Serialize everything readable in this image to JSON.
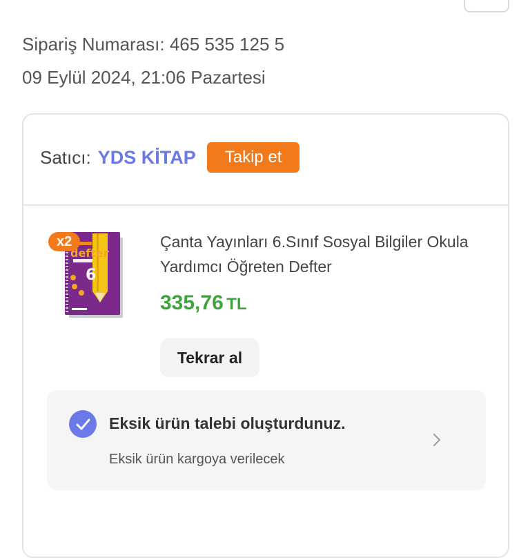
{
  "order": {
    "number_line": "Sipariş Numarası: 465 535 125 5",
    "date_line": "09 Eylül 2024, 21:06 Pazartesi"
  },
  "seller": {
    "label": "Satıcı:",
    "name": "YDS KİTAP",
    "follow_label": "Takip et"
  },
  "product": {
    "quantity_badge": "x2",
    "title": "Çanta Yayınları 6.Sınıf Sosyal Bilgiler Okula Yardımcı Öğreten Defter",
    "price_amount": "335,76",
    "price_currency": "TL",
    "cover_word": "defter",
    "cover_grade": "6"
  },
  "actions": {
    "rebuy_label": "Tekrar al"
  },
  "notice": {
    "title": "Eksik ürün talebi oluşturdunuz.",
    "subtitle": "Eksik ürün kargoya verilecek"
  },
  "colors": {
    "accent_orange": "#f27a1a",
    "seller_blue": "#6a79e6",
    "price_green": "#3fa43f"
  }
}
